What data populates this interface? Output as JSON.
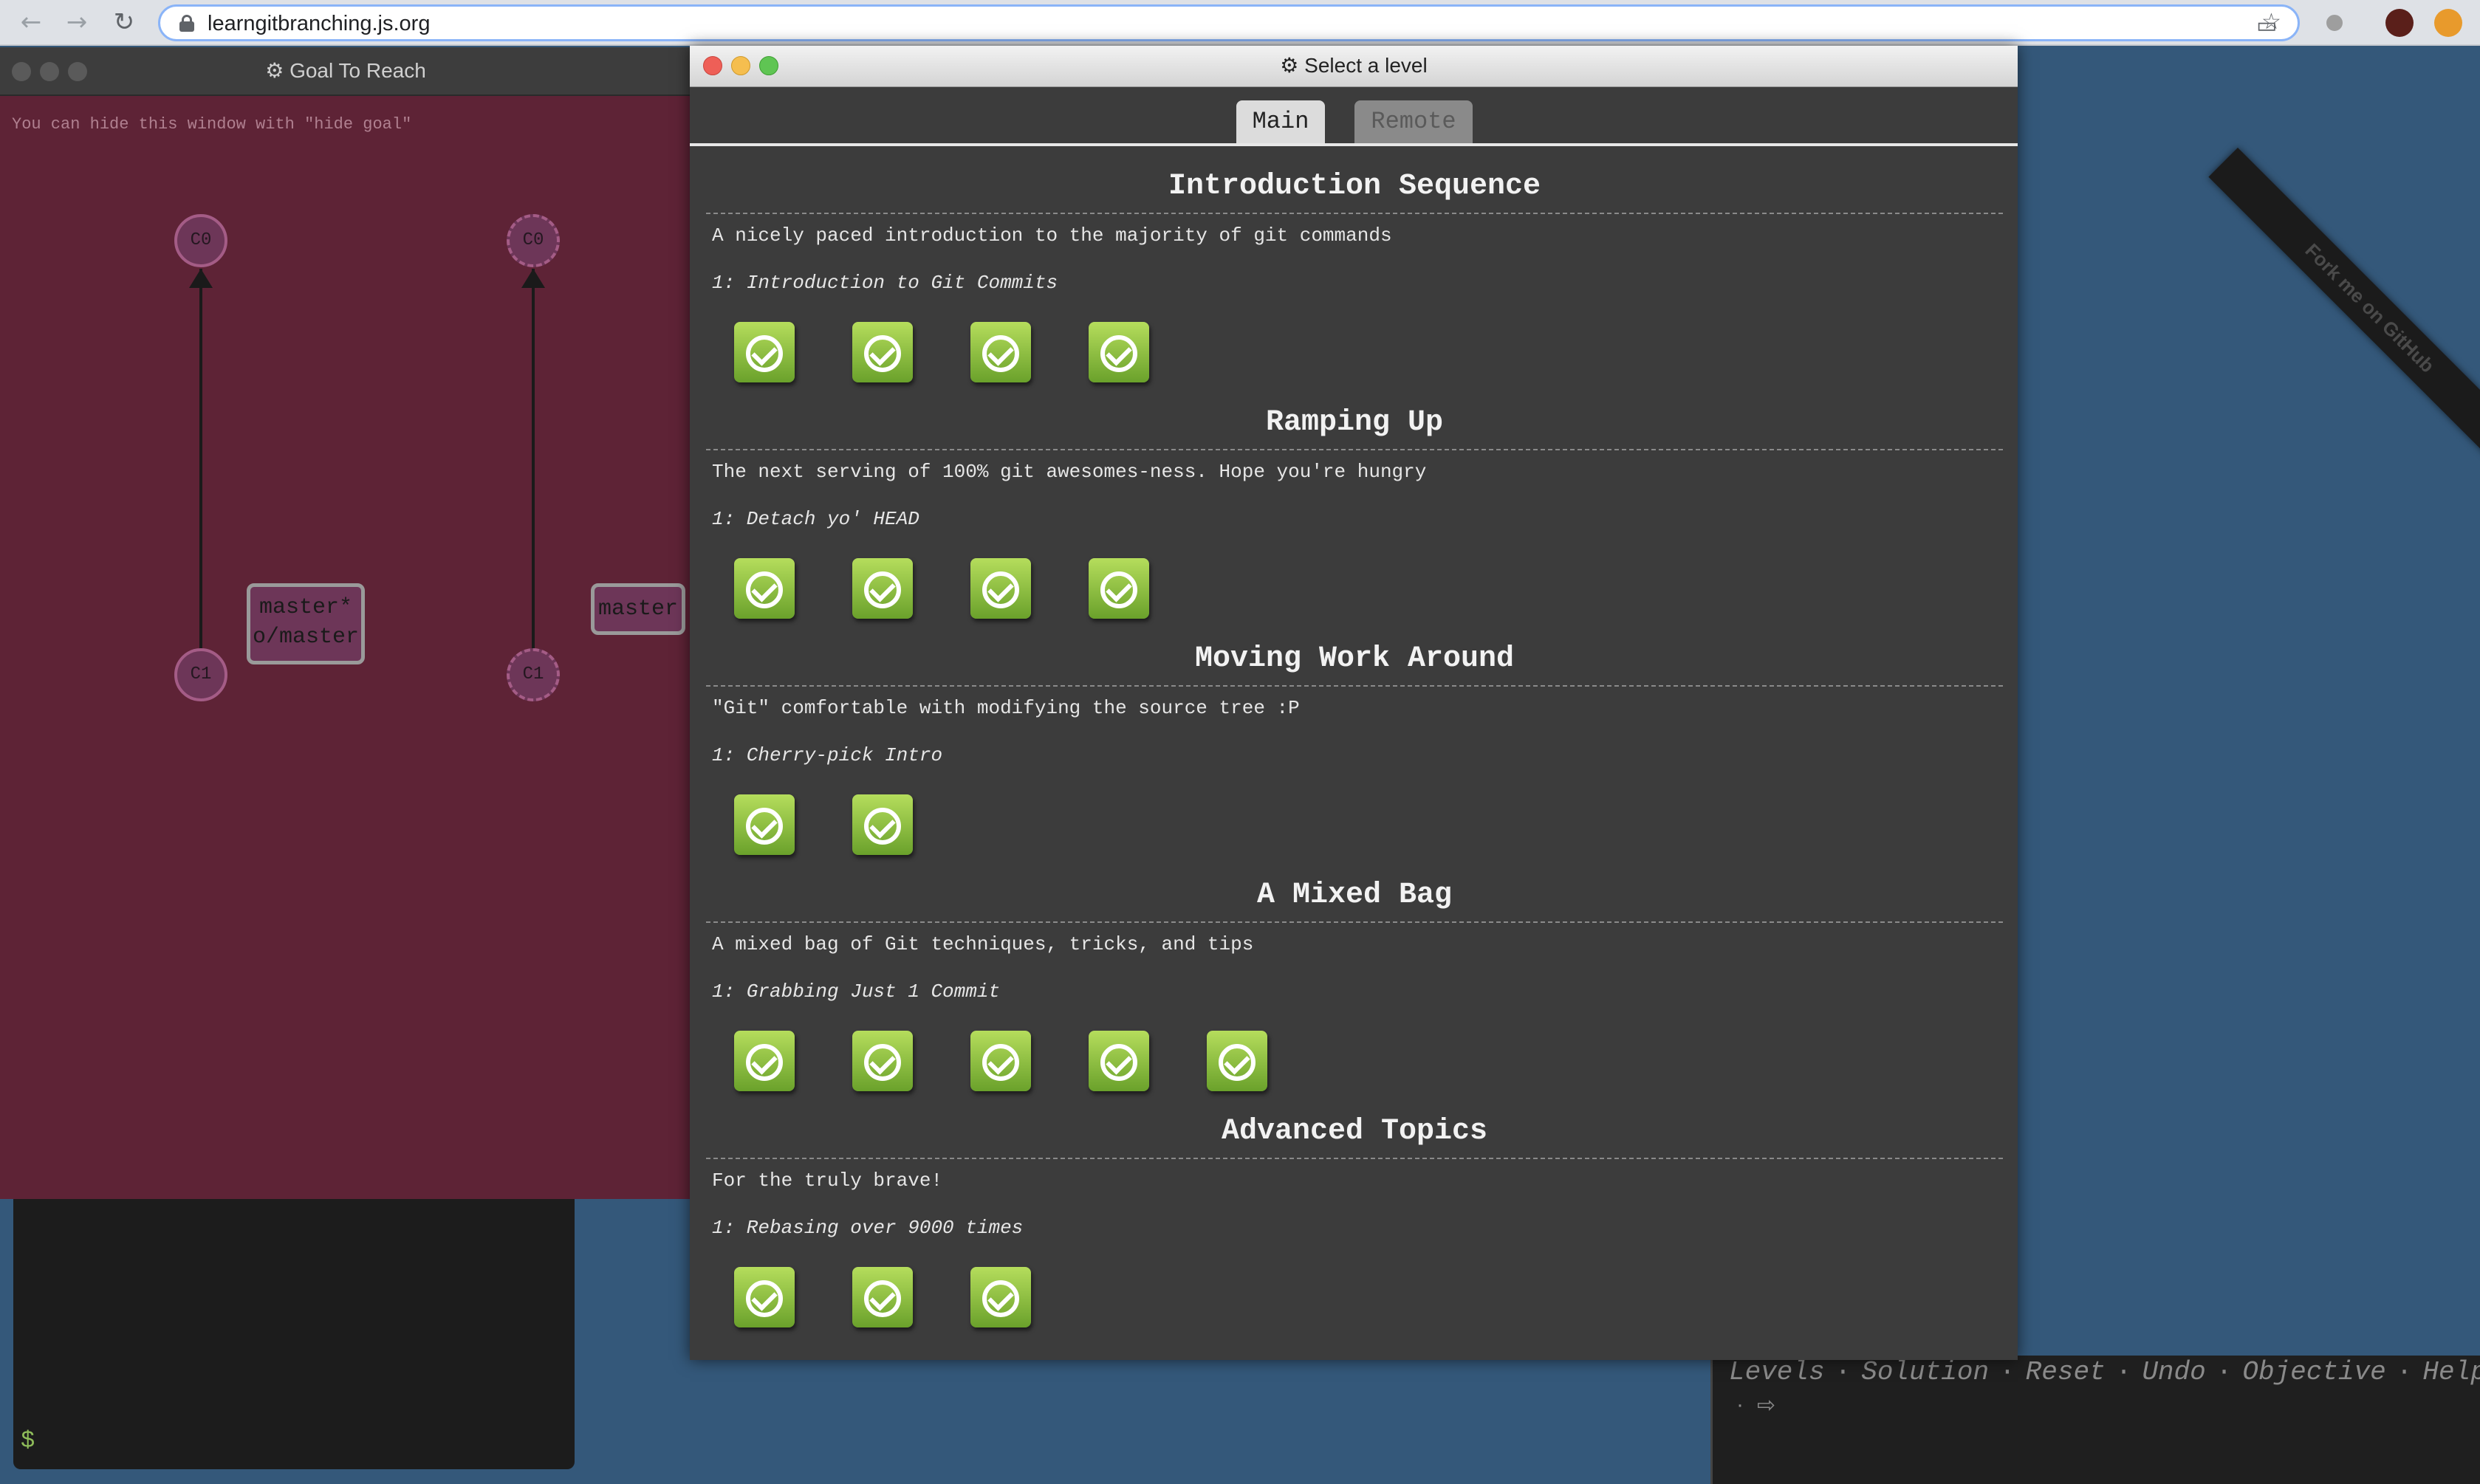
{
  "browser": {
    "url": "learngitbranching.js.org",
    "back_icon": "arrow-back-icon",
    "forward_icon": "arrow-forward-icon",
    "reload_icon": "reload-icon"
  },
  "goal_window": {
    "title": "Goal To Reach",
    "hint": "You can hide this window with \"hide goal\"",
    "left_graph": {
      "commits": [
        "C0",
        "C1"
      ],
      "branch_lines": [
        "master*",
        "o/master"
      ]
    },
    "right_graph": {
      "commits": [
        "C0",
        "C1"
      ],
      "branch": "master"
    }
  },
  "terminal": {
    "prompt": "$",
    "commands": [
      "Levels",
      "Solution",
      "Reset",
      "Undo",
      "Objective",
      "Help"
    ],
    "separator": "·"
  },
  "ribbon": {
    "text": "Fork me on GitHub"
  },
  "level_window": {
    "title": "Select a level",
    "tabs": [
      {
        "label": "Main",
        "active": true
      },
      {
        "label": "Remote",
        "active": false
      }
    ],
    "sequences": [
      {
        "title": "Introduction Sequence",
        "description": "A nicely paced introduction to the majority of git commands",
        "about": "1: Introduction to Git Commits",
        "levels_completed": 4
      },
      {
        "title": "Ramping Up",
        "description": "The next serving of 100% git awesomes-ness. Hope you're hungry",
        "about": "1: Detach yo' HEAD",
        "levels_completed": 4
      },
      {
        "title": "Moving Work Around",
        "description": "\"Git\" comfortable with modifying the source tree :P",
        "about": "1: Cherry-pick Intro",
        "levels_completed": 2
      },
      {
        "title": "A Mixed Bag",
        "description": "A mixed bag of Git techniques, tricks, and tips",
        "about": "1: Grabbing Just 1 Commit",
        "levels_completed": 5
      },
      {
        "title": "Advanced Topics",
        "description": "For the truly brave!",
        "about": "1: Rebasing over 9000 times",
        "levels_completed": 3
      }
    ]
  },
  "colors": {
    "goal_bg": "#5e2336",
    "page_bg": "#34587a",
    "level_complete": "#8cc43c"
  }
}
